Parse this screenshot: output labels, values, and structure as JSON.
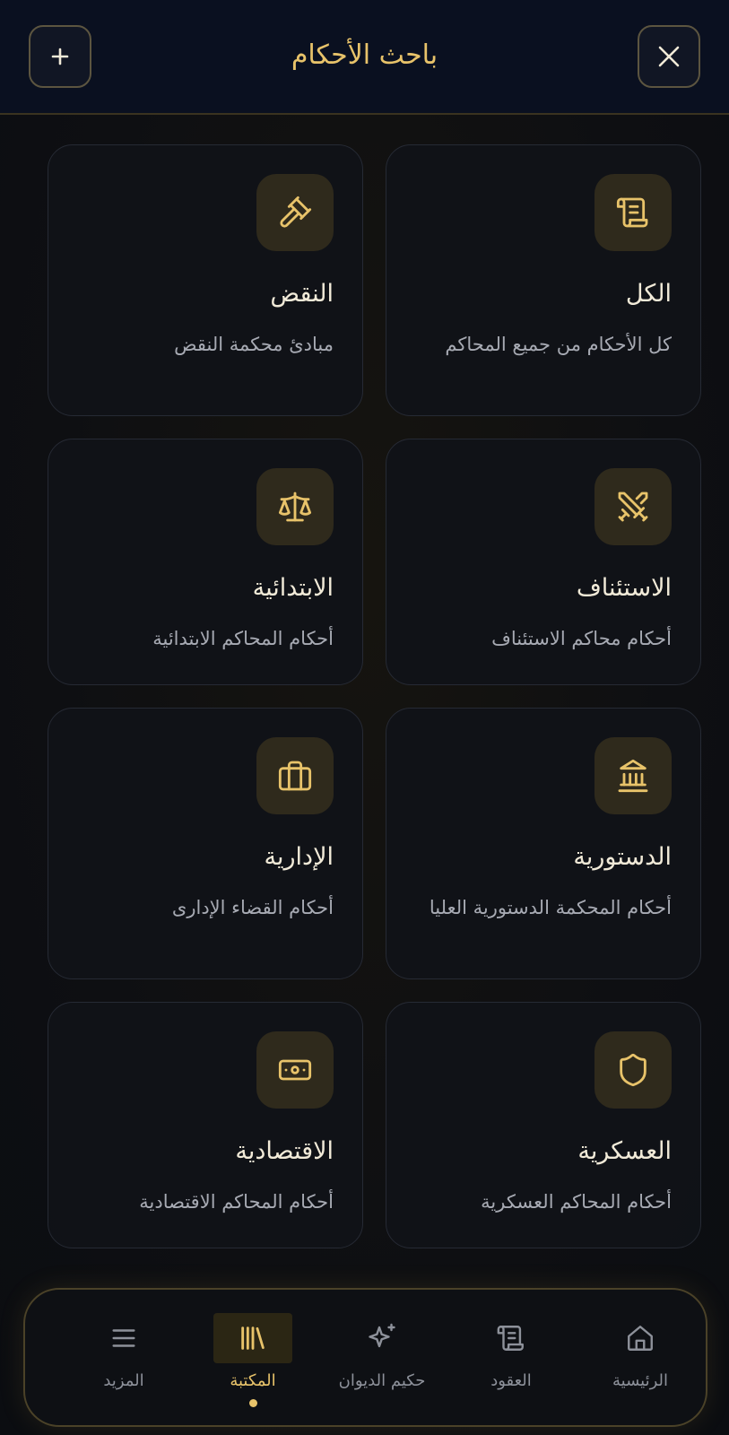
{
  "header": {
    "title": "باحث الأحكام",
    "add_icon": "plus-icon",
    "close_icon": "close-icon"
  },
  "categories": [
    {
      "title": "الكل",
      "desc": "كل الأحكام من جميع المحاكم",
      "icon": "scroll-icon"
    },
    {
      "title": "النقض",
      "desc": "مبادئ محكمة النقض",
      "icon": "gavel-icon"
    },
    {
      "title": "الاستئناف",
      "desc": "أحكام محاكم الاستئناف",
      "icon": "swords-icon"
    },
    {
      "title": "الابتدائية",
      "desc": "أحكام المحاكم الابتدائية",
      "icon": "scales-icon"
    },
    {
      "title": "الدستورية",
      "desc": "أحكام المحكمة الدستورية العليا",
      "icon": "landmark-icon"
    },
    {
      "title": "الإدارية",
      "desc": "أحكام القضاء الإدارى",
      "icon": "briefcase-icon"
    },
    {
      "title": "العسكرية",
      "desc": "أحكام المحاكم العسكرية",
      "icon": "shield-icon"
    },
    {
      "title": "الاقتصادية",
      "desc": "أحكام المحاكم الاقتصادية",
      "icon": "banknote-icon"
    }
  ],
  "nav": [
    {
      "label": "الرئيسية",
      "icon": "home-icon",
      "active": false
    },
    {
      "label": "العقود",
      "icon": "scroll-icon",
      "active": false
    },
    {
      "label": "حكيم الديوان",
      "icon": "sparkles-icon",
      "active": false
    },
    {
      "label": "المكتبة",
      "icon": "library-icon",
      "active": true
    },
    {
      "label": "المزيد",
      "icon": "menu-icon",
      "active": false
    }
  ],
  "colors": {
    "accent": "#e8c36a",
    "header_bg": "#0a1020",
    "card_bg": "#101218",
    "icon_tile_bg": "#2f2a1c"
  }
}
